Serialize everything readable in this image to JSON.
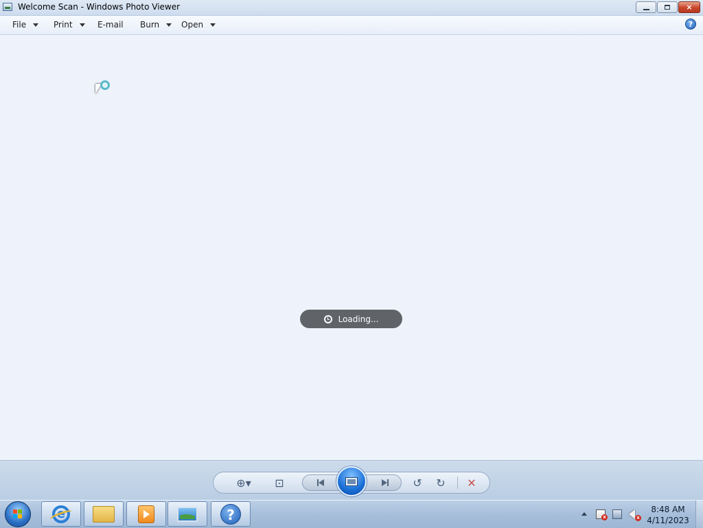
{
  "window": {
    "title": "Welcome Scan - Windows Photo Viewer",
    "app_icon": "photo-viewer-icon",
    "controls": {
      "minimize_icon": "minimize-icon",
      "maximize_icon": "restore-icon",
      "close_label": "×"
    }
  },
  "menu": {
    "items": [
      {
        "label": "File",
        "has_dropdown": true
      },
      {
        "label": "Print",
        "has_dropdown": true
      },
      {
        "label": "E-mail",
        "has_dropdown": false
      },
      {
        "label": "Burn",
        "has_dropdown": true
      },
      {
        "label": "Open",
        "has_dropdown": true
      }
    ],
    "help_label": "?"
  },
  "viewer": {
    "status": "Loading...",
    "status_icon": "clock-icon"
  },
  "controls": {
    "zoom_icon": "zoom-icon",
    "zoom_label": "⊕▾",
    "fit_icon": "actual-size-icon",
    "fit_label": "⊡",
    "previous_icon": "previous-icon",
    "slideshow_icon": "slideshow-icon",
    "next_icon": "next-icon",
    "rotate_ccw_icon": "rotate-counterclockwise-icon",
    "rotate_ccw_label": "↺",
    "rotate_cw_icon": "rotate-clockwise-icon",
    "rotate_cw_label": "↻",
    "delete_icon": "delete-icon",
    "delete_label": "✕",
    "delete_color": "#c85050"
  },
  "taskbar": {
    "start_icon": "windows-start-icon",
    "pinned": [
      {
        "name": "internet-explorer",
        "icon": "internet-explorer-icon",
        "label": "e"
      },
      {
        "name": "windows-explorer",
        "icon": "folder-icon"
      },
      {
        "name": "media-player",
        "icon": "media-player-icon"
      },
      {
        "name": "photo-viewer",
        "icon": "photo-viewer-icon"
      },
      {
        "name": "help-and-support",
        "icon": "help-icon",
        "label": "?"
      }
    ],
    "tray": {
      "show_hidden_icon": "chevron-up-icon",
      "icons": [
        "action-center-flag-icon",
        "network-icon",
        "volume-muted-icon"
      ],
      "time": "8:48 AM",
      "date": "4/11/2023"
    }
  }
}
